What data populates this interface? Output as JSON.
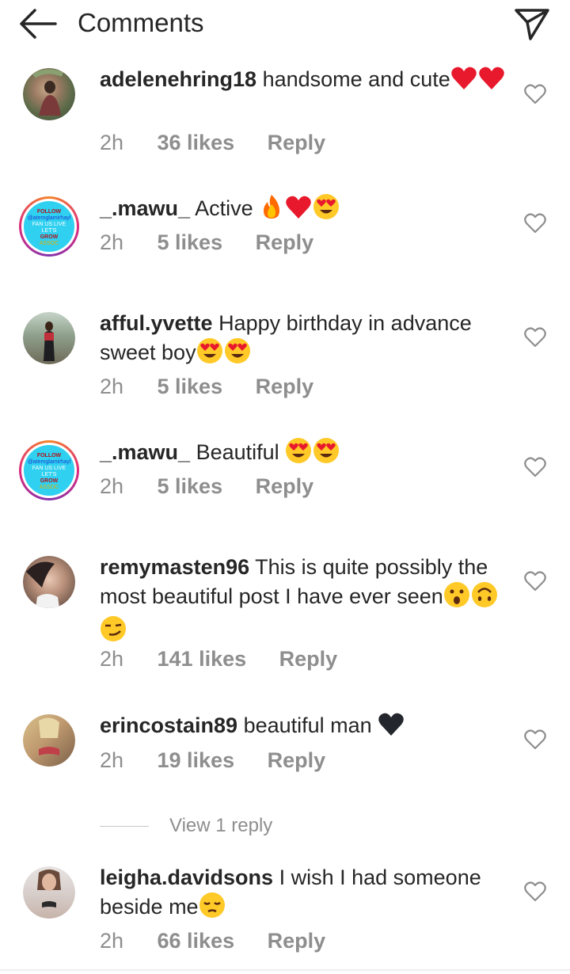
{
  "header": {
    "title": "Comments",
    "back_icon": "arrow-left-icon",
    "share_icon": "paper-plane-icon"
  },
  "meta_labels": {
    "reply": "Reply"
  },
  "view_replies": {
    "label": "View 1 reply"
  },
  "colors": {
    "text": "#262626",
    "secondary": "#8e8e8e",
    "heart_red": "#e8192c",
    "story_ring": [
      "#f58529",
      "#dd2a7b",
      "#8134af"
    ]
  },
  "comments": [
    {
      "username": "adelenehring18",
      "text": "handsome and cute",
      "emojis": [
        "red-heart",
        "red-heart"
      ],
      "time": "2h",
      "likes": "36 likes",
      "avatar": "photo-woman"
    },
    {
      "username": "_.mawu_",
      "text": "Active",
      "emojis": [
        "fire",
        "red-heart",
        "heart-eyes"
      ],
      "time": "2h",
      "likes": "5 likes",
      "avatar": "follow-badge"
    },
    {
      "username": "afful.yvette",
      "text": "Happy birthday in advance sweet boy",
      "emojis": [
        "heart-eyes",
        "heart-eyes"
      ],
      "time": "2h",
      "likes": "5 likes",
      "avatar": "photo-outdoor"
    },
    {
      "username": "_.mawu_",
      "text": "Beautiful",
      "emojis": [
        "heart-eyes",
        "heart-eyes"
      ],
      "time": "2h",
      "likes": "5 likes",
      "avatar": "follow-badge"
    },
    {
      "username": "remymasten96",
      "text": "This is quite possibly the most beautiful post I have ever seen",
      "emojis": [
        "hushed-face",
        "upside-down-face",
        "smirking-face"
      ],
      "time": "2h",
      "likes": "141 likes",
      "avatar": "photo-woman"
    },
    {
      "username": "erincostain89",
      "text": "beautiful man",
      "emojis": [
        "black-heart"
      ],
      "time": "2h",
      "likes": "19 likes",
      "avatar": "photo-woman"
    },
    {
      "username": "leigha.davidsons",
      "text": "I wish I had someone beside me",
      "emojis": [
        "pensive-face"
      ],
      "time": "2h",
      "likes": "66 likes",
      "avatar": "photo-woman-light"
    }
  ],
  "follow_badge": {
    "line1": "FOLLOW",
    "line2": "@atemglamirhayl",
    "line3": "FAN US LIVE",
    "line4": "LET'S",
    "line5": "GROW",
    "line6": "ASSOC"
  }
}
